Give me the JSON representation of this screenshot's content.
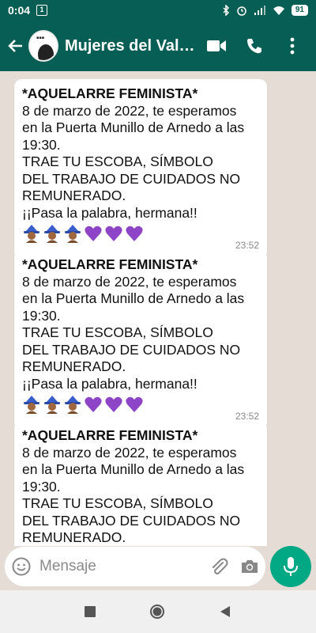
{
  "status": {
    "time": "0:04",
    "notif": "1",
    "battery": "91"
  },
  "header": {
    "title": "Mujeres del Valle..."
  },
  "input": {
    "placeholder": "Mensaje"
  },
  "messages": [
    {
      "lines": [
        "*AQUELARRE FEMINISTA*",
        "8 de marzo de 2022, te esperamos",
        "en la Puerta Munillo de Arnedo a las",
        "19:30.",
        "TRAE TU ESCOBA, SÍMBOLO",
        "DEL TRABAJO DE CUIDADOS NO",
        "REMUNERADO.",
        "¡¡Pasa la palabra, hermana!!"
      ],
      "time": "23:52"
    },
    {
      "lines": [
        "*AQUELARRE FEMINISTA*",
        "8 de marzo de 2022, te esperamos",
        "en la Puerta Munillo de Arnedo a las",
        "19:30.",
        "TRAE TU ESCOBA, SÍMBOLO",
        "DEL TRABAJO DE CUIDADOS NO",
        "REMUNERADO.",
        "¡¡Pasa la palabra, hermana!!"
      ],
      "time": "23:52"
    },
    {
      "lines": [
        "*AQUELARRE FEMINISTA*",
        "8 de marzo de 2022, te esperamos",
        "en la Puerta Munillo de Arnedo a las",
        "19:30.",
        "TRAE TU ESCOBA, SÍMBOLO",
        "DEL TRABAJO DE CUIDADOS NO",
        "REMUNERADO."
      ]
    }
  ],
  "icons": {
    "back": "back-arrow-icon",
    "video": "video-call-icon",
    "call": "phone-icon",
    "menu": "more-vert-icon",
    "emoji": "emoji-icon",
    "attach": "paperclip-icon",
    "camera": "camera-icon",
    "mic": "mic-icon",
    "witch": "woman-mage-emoji",
    "heart": "purple-heart-emoji"
  },
  "colors": {
    "header": "#075e54",
    "accent": "#00a884",
    "chat_bg": "#e5ddd5",
    "heart": "#8e44c6"
  }
}
